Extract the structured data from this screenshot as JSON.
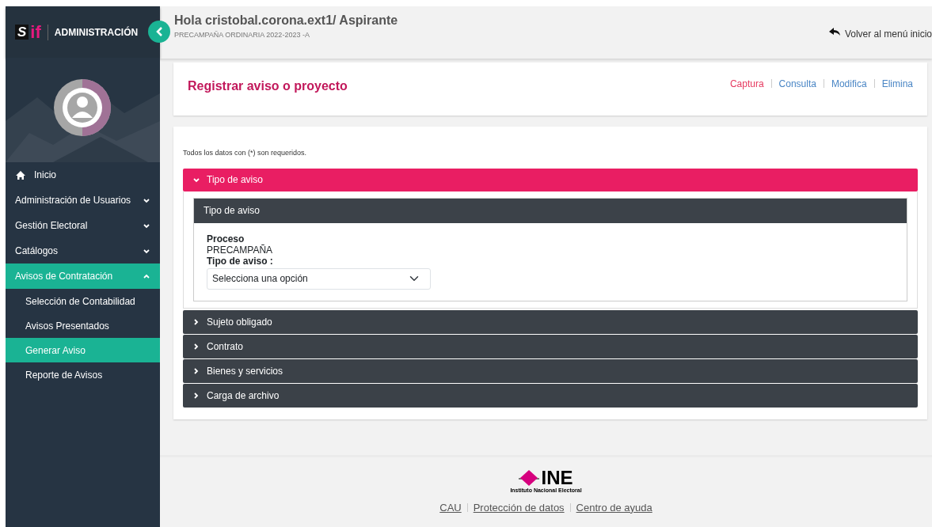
{
  "sidebar": {
    "logo": {
      "mark": "S",
      "suffix": "if"
    },
    "brand": "ADMINISTRACIÓN",
    "collapse_button": {
      "kind": "chevron-left"
    },
    "items": [
      {
        "label": "Inicio",
        "kind": "home",
        "selected": false
      },
      {
        "label": "Administración de Usuarios",
        "kind": "group",
        "expanded": false,
        "selected": false
      },
      {
        "label": "Gestión Electoral",
        "kind": "group",
        "expanded": false,
        "selected": false
      },
      {
        "label": "Catálogos",
        "kind": "group",
        "expanded": false,
        "selected": false
      },
      {
        "label": "Avisos de Contratación",
        "kind": "group",
        "expanded": true,
        "selected": true,
        "children": [
          {
            "label": "Selección de Contabilidad",
            "selected": false
          },
          {
            "label": "Avisos Presentados",
            "selected": false
          },
          {
            "label": "Generar Aviso",
            "selected": true
          },
          {
            "label": "Reporte de Avisos",
            "selected": false
          }
        ]
      }
    ]
  },
  "header": {
    "title": "Hola cristobal.corona.ext1/ Aspirante",
    "subtitle": "PRECAMPAÑA ORDINARIA 2022-2023 -A",
    "back_link": "Volver al menú inicio"
  },
  "page_title": "Registrar aviso o proyecto",
  "actions": [
    {
      "label": "Captura",
      "selected": true
    },
    {
      "label": "Consulta",
      "selected": false
    },
    {
      "label": "Modifica",
      "selected": false
    },
    {
      "label": "Elimina",
      "selected": false
    }
  ],
  "form": {
    "note": "Todos los datos con (*) son requeridos.",
    "sections": [
      {
        "label": "Tipo de aviso",
        "expanded": true,
        "panel": {
          "title": "Tipo de aviso",
          "fields": [
            {
              "kind": "static",
              "label": "Proceso",
              "value": "PRECAMPAÑA"
            },
            {
              "kind": "select",
              "label": "Tipo de aviso :",
              "placeholder": "Selecciona una opción"
            }
          ]
        }
      },
      {
        "label": "Sujeto obligado",
        "expanded": false
      },
      {
        "label": "Contrato",
        "expanded": false
      },
      {
        "label": "Bienes y servicios",
        "expanded": false
      },
      {
        "label": "Carga de archivo",
        "expanded": false
      }
    ]
  },
  "footer": {
    "logo": {
      "name": "INE",
      "subtitle": "Instituto Nacional Electoral"
    },
    "links": [
      "CAU",
      "Protección de datos",
      "Centro de ayuda"
    ]
  }
}
